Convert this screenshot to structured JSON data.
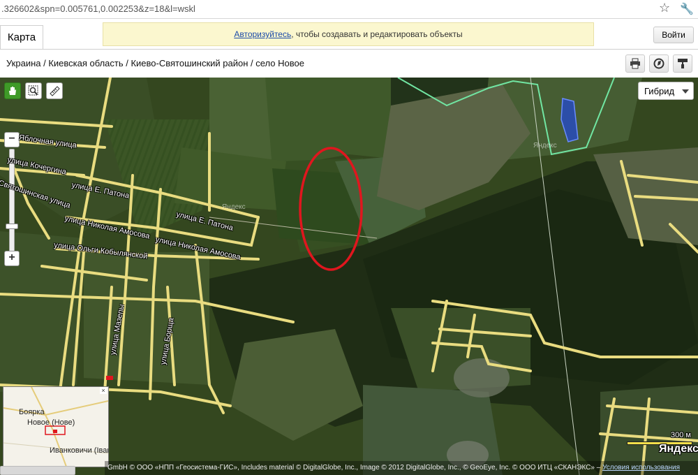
{
  "browser": {
    "url": ".326602&spn=0.005761,0.002253&z=18&l=wskl",
    "star_icon": "star-icon",
    "wrench_icon": "wrench-icon"
  },
  "header": {
    "tab_label": "Карта",
    "notice_link": "Авторизуйтесь",
    "notice_text": ", чтобы создавать и редактировать объекты",
    "login_label": "Войти",
    "breadcrumb": "Украина / Киевская область / Киево-Святошинский район / село Новое",
    "buttons": [
      "print-icon",
      "share-icon",
      "paint-icon"
    ]
  },
  "map": {
    "tools": [
      "hand-icon",
      "zoom-area-icon",
      "ruler-icon"
    ],
    "zoom": {
      "plus": "+",
      "minus": "−"
    },
    "layer": "Гибрид",
    "streets": {
      "s1": "Яблочная улица",
      "s2": "улица Кочергина",
      "s3": "Святошинская улица",
      "s4": "улица Е. Патона",
      "s5": "улица Николая Амосова",
      "s6": "улица Е. Патона",
      "s7": "улица Николая Амосова",
      "s8": "улица Ольги Кобылянской",
      "s9": "улица Мазепы",
      "s10": "улица Борща"
    },
    "watermark": "Яндекс",
    "minimap": {
      "l1": "Боярка",
      "l2": "Новое (Нове)",
      "l3": "Иванковичи (Іванк",
      "close": "×"
    },
    "scale_label": "300 м",
    "logo": "Яндекс",
    "copyright": "GmbH © ООО «НПП «Геосистема-ГИС», Includes material © DigitalGlobe, Inc., Image © 2012 DigitalGlobe, Inc., © GeoEye, Inc. © ООО ИТЦ «СКАНЭКС» – ",
    "copyright_link": "Условия использования",
    "colors": {
      "road": "#e9dc80",
      "marker": "#e0161e",
      "boundary": "#71e6a3",
      "water": "#2c4ea8"
    }
  }
}
